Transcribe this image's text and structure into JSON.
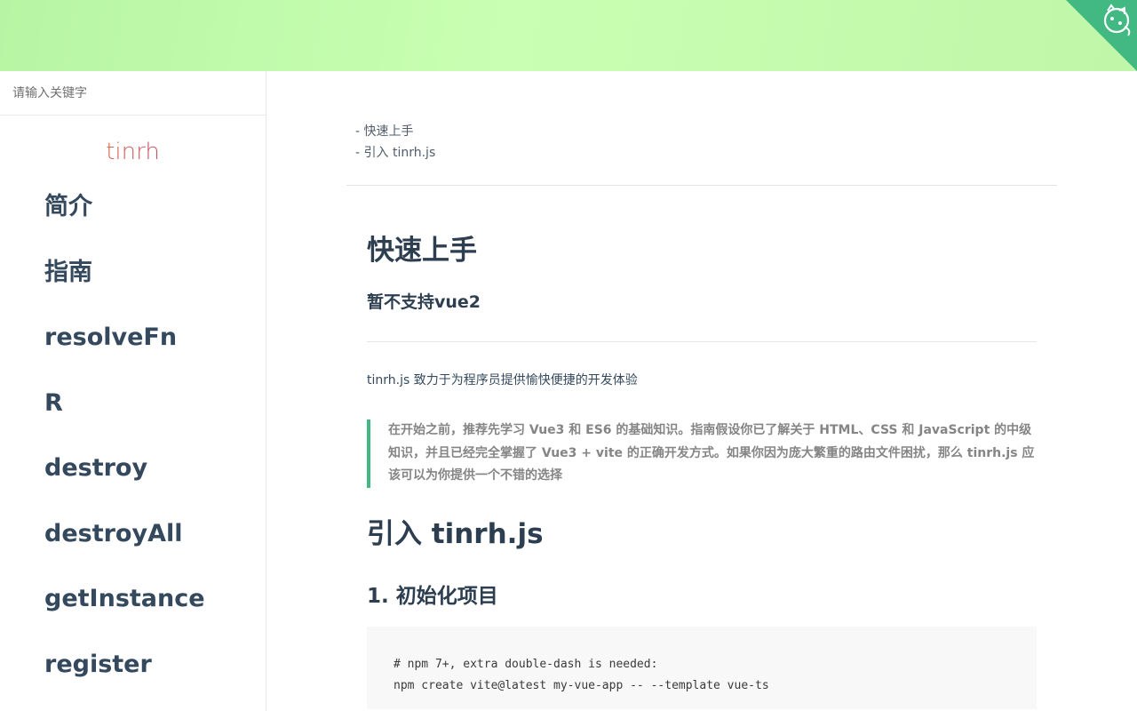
{
  "colors": {
    "header_gradient_start": "#b7f5a4",
    "header_gradient_end": "#c9ffb2",
    "corner_ribbon": "#42b983",
    "blockquote_border": "#42b983",
    "heading": "#2c3e50"
  },
  "header": {
    "corner_icon": "github-cat-icon"
  },
  "sidebar": {
    "search_placeholder": "请输入关键字",
    "app_name": "tinrh",
    "items": [
      {
        "label": "简介"
      },
      {
        "label": "指南"
      },
      {
        "label": "resolveFn"
      },
      {
        "label": "R"
      },
      {
        "label": "destroy"
      },
      {
        "label": "destroyAll"
      },
      {
        "label": "getInstance"
      },
      {
        "label": "register"
      }
    ]
  },
  "toc": {
    "items": [
      {
        "label": "快速上手"
      },
      {
        "label": "引入 tinrh.js"
      }
    ]
  },
  "content": {
    "title": "快速上手",
    "subtitle": "暂不支持vue2",
    "intro": "tinrh.js 致力于为程序员提供愉快便捷的开发体验",
    "blockquote": "在开始之前，推荐先学习 Vue3 和 ES6 的基础知识。指南假设你已了解关于 HTML、CSS 和 JavaScript 的中级知识，并且已经完全掌握了 Vue3 + vite 的正确开发方式。如果你因为庞大繁重的路由文件困扰，那么 tinrh.js 应该可以为你提供一个不错的选择",
    "section_title": "引入 tinrh.js",
    "step1_title": "1. 初始化项目",
    "code_line1": "# npm 7+, extra double-dash is needed:",
    "code_line2": "npm create vite@latest my-vue-app -- --template vue-ts"
  }
}
